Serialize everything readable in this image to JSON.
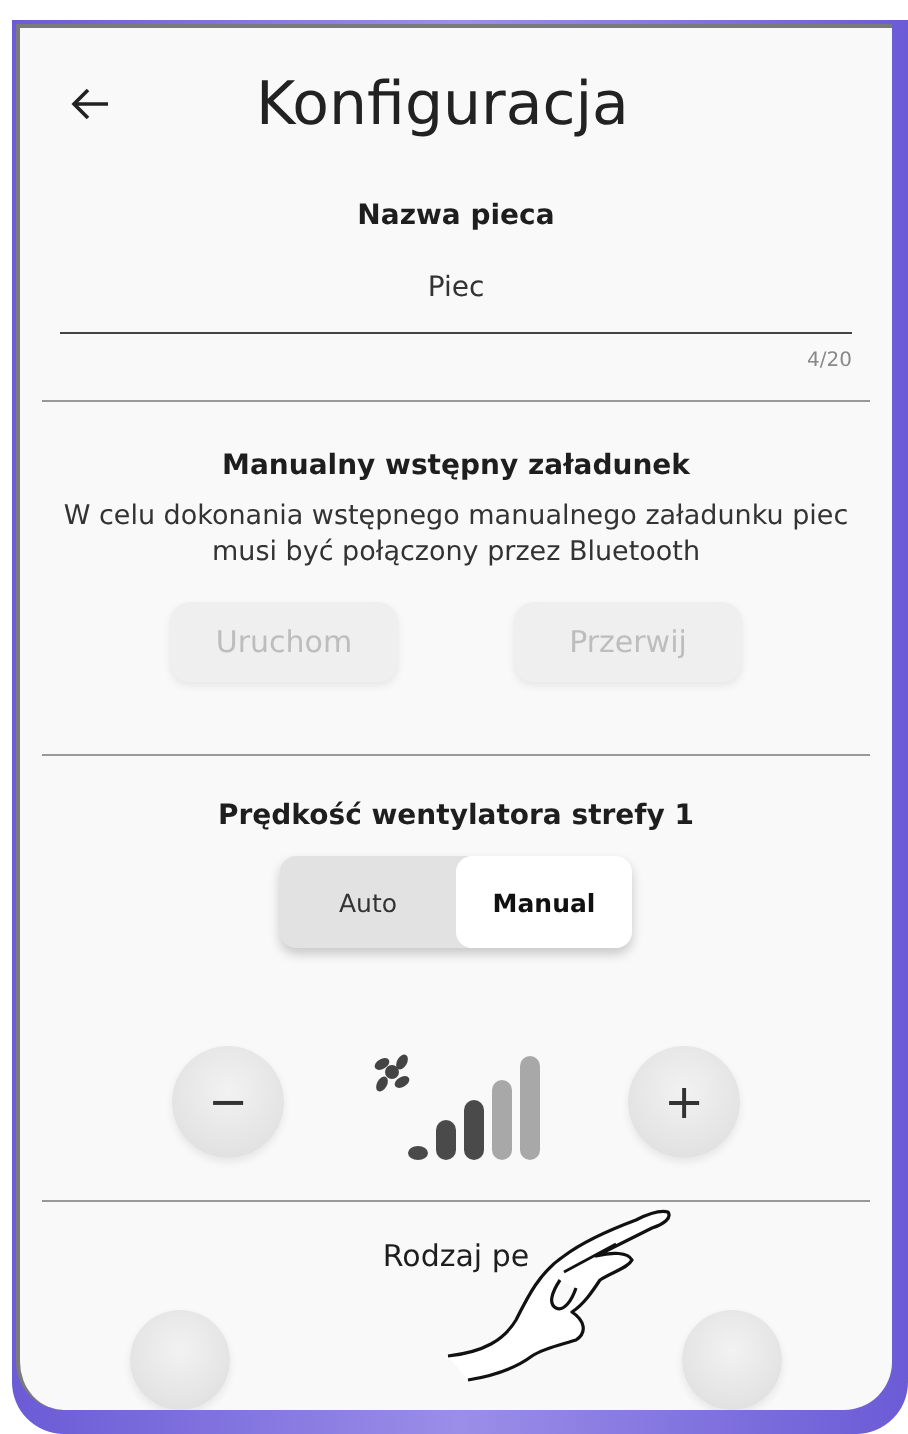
{
  "header": {
    "title": "Konfiguracja"
  },
  "furnace_name": {
    "heading": "Nazwa pieca",
    "value": "Piec",
    "counter": "4/20"
  },
  "manual_loading": {
    "heading": "Manualny wstępny załadunek",
    "description": "W celu dokonania wstępnego manualnego załadunku piec musi być połączony przez Bluetooth",
    "buttons": [
      {
        "label": "Uruchom",
        "disabled": true
      },
      {
        "label": "Przerwij",
        "disabled": true
      }
    ]
  },
  "fan_speed": {
    "heading": "Prędkość wentylatora strefy 1",
    "modes": [
      {
        "label": "Auto",
        "selected": false
      },
      {
        "label": "Manual",
        "selected": true
      }
    ],
    "minus": "−",
    "plus": "+",
    "level": 0.6
  },
  "pellet_type": {
    "heading": "Rodzaj pe"
  }
}
